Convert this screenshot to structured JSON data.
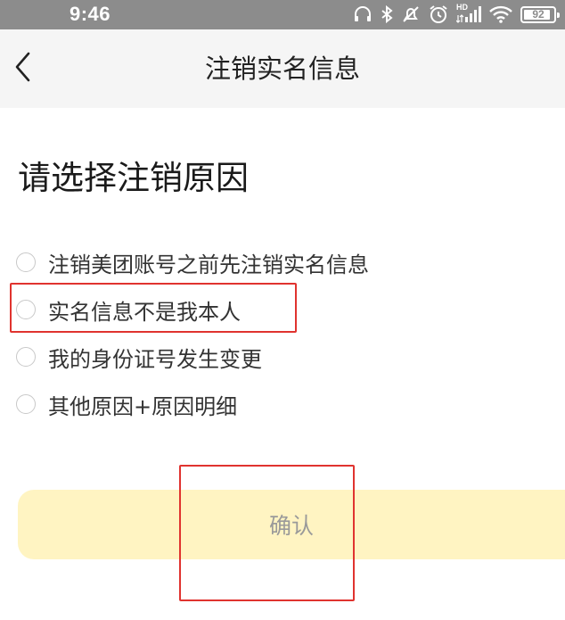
{
  "status_bar": {
    "time": "9:46",
    "icons": [
      "headphones-icon",
      "bluetooth-icon",
      "mute-icon",
      "alarm-icon",
      "hd-signal-icon",
      "wifi-icon",
      "battery-icon"
    ],
    "signal_badge": "HD",
    "battery_level": "92"
  },
  "nav": {
    "back_icon": "chevron-left-icon",
    "title": "注销实名信息"
  },
  "page": {
    "heading": "请选择注销原因",
    "options": [
      {
        "label": "注销美团账号之前先注销实名信息",
        "selected": false
      },
      {
        "label": "实名信息不是我本人",
        "selected": false
      },
      {
        "label": "我的身份证号发生变更",
        "selected": false
      },
      {
        "label": "其他原因+原因明细",
        "selected": false
      }
    ],
    "confirm_label": "确认"
  },
  "colors": {
    "status_bar_bg": "#8c8c8c",
    "nav_bg": "#f5f5f5",
    "confirm_bg": "#fff4c2",
    "highlight_border": "#e0332f"
  }
}
